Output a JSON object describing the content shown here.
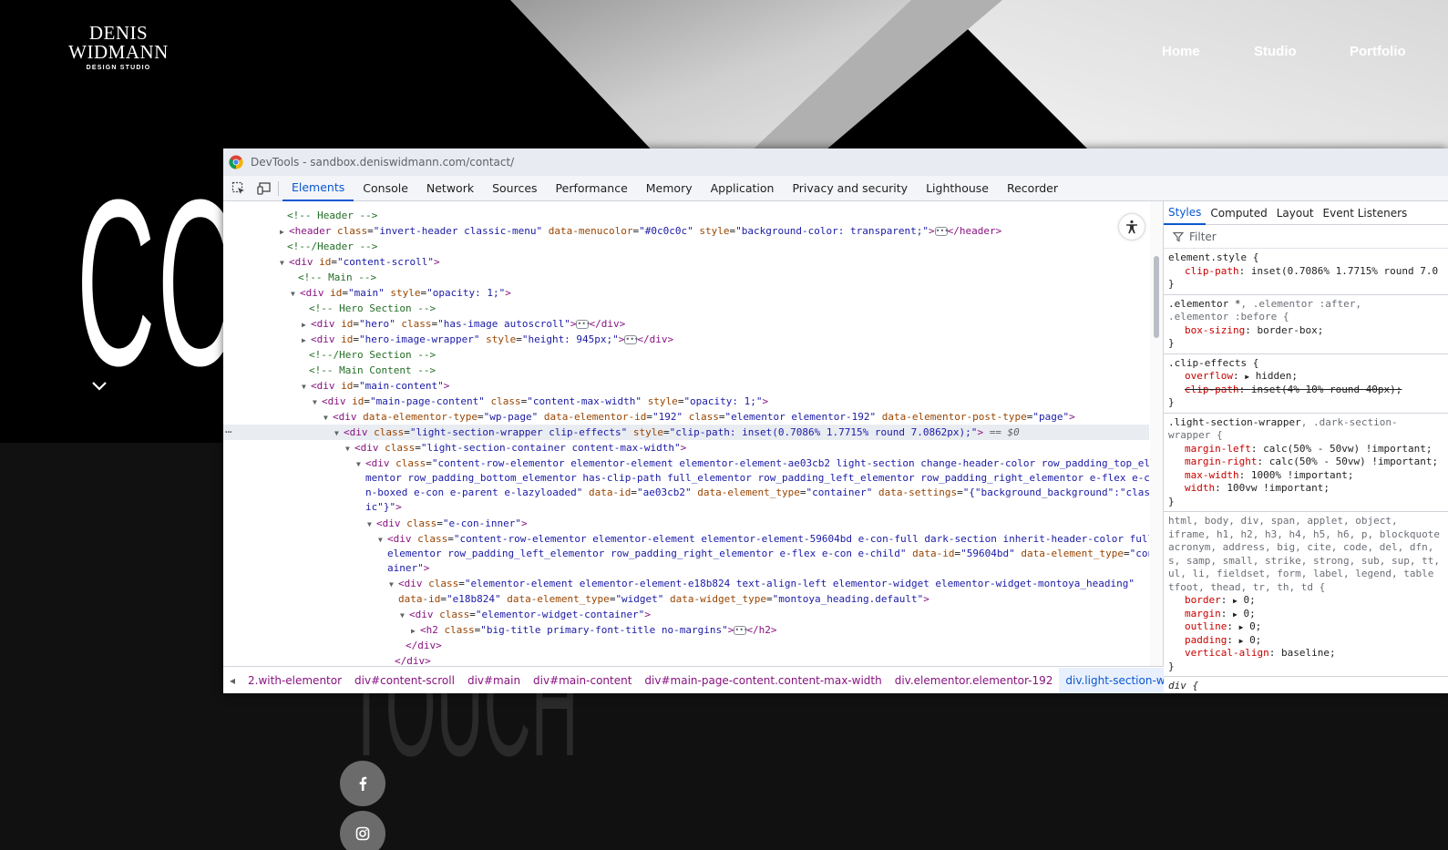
{
  "site": {
    "logo": {
      "line1": "DENIS",
      "line2": "WIDMANN",
      "line3": "DESIGN STUDIO"
    },
    "nav": [
      {
        "label": "Home"
      },
      {
        "label": "Studio"
      },
      {
        "label": "Portfolio"
      }
    ],
    "hero_title": "CON",
    "bottom_title": "TOUCH"
  },
  "devtools": {
    "title": "DevTools - sandbox.deniswidmann.com/contact/",
    "tabs": [
      "Elements",
      "Console",
      "Network",
      "Sources",
      "Performance",
      "Memory",
      "Application",
      "Privacy and security",
      "Lighthouse",
      "Recorder"
    ],
    "active_tab": "Elements",
    "dom": {
      "l1": {
        "comment": "<!-- Header -->"
      },
      "l2": {
        "tag_open": "<header",
        "a1": "class",
        "v1": "\"invert-header classic-menu\"",
        "a2": "data-menucolor",
        "v2": "\"#0c0c0c\"",
        "a3": "style",
        "v3": "\"background-color: transparent;\"",
        "close": "</header>"
      },
      "l3": {
        "comment": "<!--/Header -->"
      },
      "l4": {
        "tag_open": "<div",
        "a1": "id",
        "v1": "\"content-scroll\""
      },
      "l5": {
        "comment": "<!-- Main -->"
      },
      "l6": {
        "tag_open": "<div",
        "a1": "id",
        "v1": "\"main\"",
        "a2": "style",
        "v2": "\"opacity: 1;\""
      },
      "l7": {
        "comment": "<!-- Hero Section -->"
      },
      "l8": {
        "tag_open": "<div",
        "a1": "id",
        "v1": "\"hero\"",
        "a2": "class",
        "v2": "\"has-image autoscroll\"",
        "close": "</div>"
      },
      "l9": {
        "tag_open": "<div",
        "a1": "id",
        "v1": "\"hero-image-wrapper\"",
        "a2": "style",
        "v2": "\"height: 945px;\"",
        "close": "</div>"
      },
      "l10": {
        "comment": "<!--/Hero Section -->"
      },
      "l11": {
        "comment": "<!-- Main Content -->"
      },
      "l12": {
        "tag_open": "<div",
        "a1": "id",
        "v1": "\"main-content\""
      },
      "l13": {
        "tag_open": "<div",
        "a1": "id",
        "v1": "\"main-page-content\"",
        "a2": "class",
        "v2": "\"content-max-width\"",
        "a3": "style",
        "v3": "\"opacity: 1;\""
      },
      "l14": {
        "tag_open": "<div",
        "a1": "data-elementor-type",
        "v1": "\"wp-page\"",
        "a2": "data-elementor-id",
        "v2": "\"192\"",
        "a3": "class",
        "v3": "\"elementor elementor-192\"",
        "a4": "data-elementor-post-type",
        "v4": "\"page\""
      },
      "l15": {
        "tag_open": "<div",
        "a1": "class",
        "v1": "\"light-section-wrapper clip-effects\"",
        "a2": "style",
        "v2": "\"clip-path: inset(0.7086% 1.7715% round 7.0862px);\"",
        "marker": "== $0"
      },
      "l16": {
        "tag_open": "<div",
        "a1": "class",
        "v1": "\"light-section-container content-max-width\""
      },
      "l17": {
        "tag_open": "<div",
        "a1": "class",
        "v1": "\"content-row-elementor elementor-element elementor-element-ae03cb2 light-section change-header-color row_padding_top_ele"
      },
      "l18": {
        "text": "mentor row_padding_bottom_elementor has-clip-path full_elementor row_padding_left_elementor row_padding_right_elementor e-flex e-co"
      },
      "l19": {
        "text": "n-boxed e-con e-parent e-lazyloaded\"",
        "a1": "data-id",
        "v1": "\"ae03cb2\"",
        "a2": "data-element_type",
        "v2": "\"container\"",
        "a3": "data-settings",
        "v3": "\"{\"background_background\":\"clas"
      },
      "l20": {
        "text": "ic\"}\""
      },
      "l21": {
        "tag_open": "<div",
        "a1": "class",
        "v1": "\"e-con-inner\""
      },
      "l22": {
        "tag_open": "<div",
        "a1": "class",
        "v1": "\"content-row-elementor elementor-element elementor-element-59604bd e-con-full dark-section inherit-header-color full_"
      },
      "l23": {
        "text": "elementor row_padding_left_elementor row_padding_right_elementor e-flex e-con e-child\"",
        "a1": "data-id",
        "v1": "\"59604bd\"",
        "a2": "data-element_type",
        "v2": "\"cont"
      },
      "l24": {
        "text": "ainer\""
      },
      "l25": {
        "tag_open": "<div",
        "a1": "class",
        "v1": "\"elementor-element elementor-element-e18b824 text-align-left elementor-widget elementor-widget-montoya_heading\""
      },
      "l26": {
        "a1": "data-id",
        "v1": "\"e18b824\"",
        "a2": "data-element_type",
        "v2": "\"widget\"",
        "a3": "data-widget_type",
        "v3": "\"montoya_heading.default\""
      },
      "l27": {
        "tag_open": "<div",
        "a1": "class",
        "v1": "\"elementor-widget-container\""
      },
      "l28": {
        "tag_open": "<h2",
        "a1": "class",
        "v1": "\"big-title primary-font-title no-margins\"",
        "close": "</h2>"
      },
      "l29": {
        "close": "</div>"
      },
      "l30": {
        "close": "</div>"
      }
    },
    "breadcrumbs": [
      "2.with-elementor",
      "div#content-scroll",
      "div#main",
      "div#main-content",
      "div#main-page-content.content-max-width",
      "div.elementor.elementor-192",
      "div.light-section-wrapper.clip-effects"
    ],
    "styles": {
      "tabs": [
        "Styles",
        "Computed",
        "Layout",
        "Event Listeners"
      ],
      "filter_placeholder": "Filter",
      "r1": {
        "selector": "element.style {",
        "p1n": "clip-path",
        "p1v": "inset(0.7086% 1.7715% round 7.0"
      },
      "r2": {
        "s1": ".elementor *",
        "s2": ", .elementor :after,",
        "s3": ".elementor :before {",
        "p1n": "box-sizing",
        "p1v": "border-box;"
      },
      "r3": {
        "selector": ".clip-effects {",
        "p1n": "overflow",
        "p1v": "hidden;",
        "p2n": "clip-path",
        "p2v": "inset(4% 10% round 40px);"
      },
      "r4": {
        "s1": ".light-section-wrapper",
        "s2": ", .dark-section-",
        "s3": "wrapper {",
        "p1n": "margin-left",
        "p1v": "calc(50% - 50vw) !important;",
        "p2n": "margin-right",
        "p2v": "calc(50% - 50vw) !important;",
        "p3n": "max-width",
        "p3v": "1000% !important;",
        "p4n": "width",
        "p4v": "100vw !important;"
      },
      "r5": {
        "l1": "html, body, div, span, applet, object,",
        "l2": "iframe, h1, h2, h3, h4, h5, h6, p, blockquote",
        "l3": "acronym, address, big, cite, code, del, dfn,",
        "l4": "s, samp, small, strike, strong, sub, sup, tt,",
        "l5": "ul, li, fieldset, form, label, legend, table",
        "l6": "tfoot, thead, tr, th, td {",
        "p1n": "border",
        "p1v": "0;",
        "p2n": "margin",
        "p2v": "0;",
        "p3n": "outline",
        "p3v": "0;",
        "p4n": "padding",
        "p4v": "0;",
        "p5n": "vertical-align",
        "p5v": "baseline;"
      },
      "r6": {
        "selector": "div {"
      },
      "close": "}"
    }
  }
}
